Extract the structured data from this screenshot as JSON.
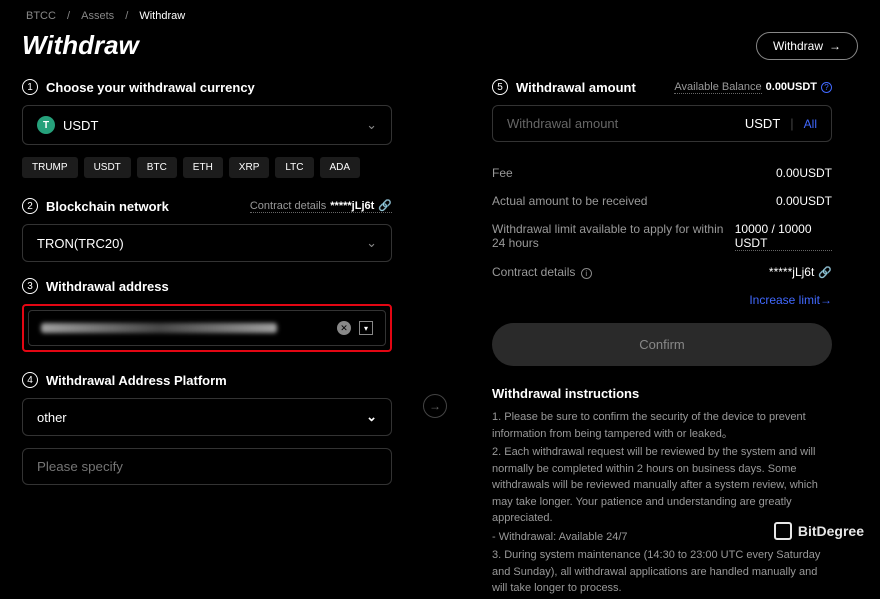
{
  "breadcrumb": {
    "a": "BTCC",
    "b": "Assets",
    "c": "Withdraw"
  },
  "page_title": "Withdraw",
  "withdraw_btn": "Withdraw",
  "steps": {
    "s1": {
      "num": "1",
      "label": "Choose your withdrawal currency"
    },
    "s2": {
      "num": "2",
      "label": "Blockchain network",
      "detail_label": "Contract details",
      "detail_val": "*****jLj6t"
    },
    "s3": {
      "num": "3",
      "label": "Withdrawal address"
    },
    "s4": {
      "num": "4",
      "label": "Withdrawal Address Platform"
    },
    "s5": {
      "num": "5",
      "label": "Withdrawal amount",
      "avail_label": "Available Balance",
      "avail_val": "0.00USDT"
    }
  },
  "currency": {
    "selected": "USDT",
    "symbol": "T"
  },
  "tags": [
    "TRUMP",
    "USDT",
    "BTC",
    "ETH",
    "XRP",
    "LTC",
    "ADA"
  ],
  "network": {
    "selected": "TRON(TRC20)"
  },
  "platform": {
    "selected": "other",
    "specify_ph": "Please specify"
  },
  "amount": {
    "placeholder": "Withdrawal amount",
    "unit": "USDT",
    "all": "All"
  },
  "info": {
    "fee_label": "Fee",
    "fee_val": "0.00USDT",
    "actual_label": "Actual amount to be received",
    "actual_val": "0.00USDT",
    "limit_label": "Withdrawal limit available to apply for within 24 hours",
    "limit_val": "10000 / 10000 USDT",
    "contract_label": "Contract details",
    "contract_val": "*****jLj6t",
    "increase": "Increase limit→"
  },
  "confirm": "Confirm",
  "instructions": {
    "title": "Withdrawal instructions",
    "p1": "1. Please be sure to confirm the security of the device to prevent information from being tampered with or leaked。",
    "p2": "2. Each withdrawal request will be reviewed by the system and will normally be completed within 2 hours on business days. Some withdrawals will be reviewed manually after a system review, which may take longer. Your patience and understanding are greatly appreciated.",
    "p2b": "- Withdrawal: Available 24/7",
    "p3": "3. During system maintenance (14:30 to 23:00 UTC every Saturday and Sunday), all withdrawal applications are handled manually and will take longer to process."
  },
  "watermark": "BitDegree"
}
